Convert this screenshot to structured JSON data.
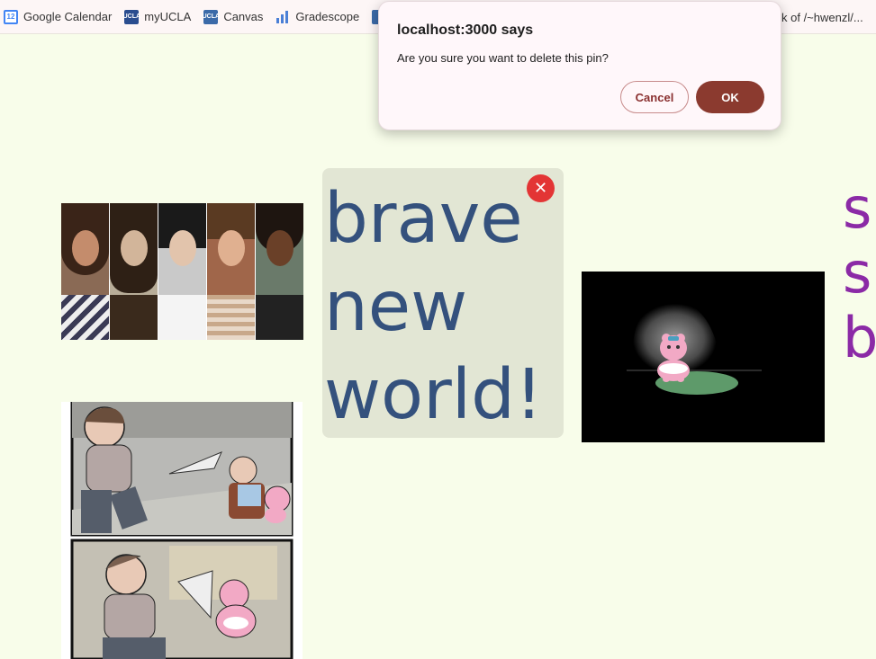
{
  "bookmarks": {
    "items": [
      {
        "label": "Google Calendar",
        "icon": "calendar-icon",
        "icon_text": "12"
      },
      {
        "label": "myUCLA",
        "icon": "ucla-icon",
        "icon_text": "UCLA"
      },
      {
        "label": "Canvas",
        "icon": "ucla-icon",
        "icon_text": "UCLA"
      },
      {
        "label": "Gradescope",
        "icon": "bar-chart-icon"
      }
    ],
    "overflow_label": "k of /~hwenzl/..."
  },
  "dialog": {
    "title": "localhost:3000 says",
    "message": "Are you sure you want to delete this pin?",
    "cancel_label": "Cancel",
    "ok_label": "OK"
  },
  "pins": {
    "text_pin": {
      "line1": "brave",
      "line2": "new",
      "line3": "world!"
    },
    "delete_icon": "close-icon",
    "cutoff_pin": {
      "line1": "s",
      "line2": "s",
      "line3": "b"
    }
  },
  "colors": {
    "page_background": "#f8fdea",
    "text_pin_background": "#e2e6d4",
    "text_pin_color": "#34517d",
    "cutoff_text_color": "#8b2aa6",
    "delete_button": "#e33535",
    "ok_button": "#8b3a2f"
  }
}
